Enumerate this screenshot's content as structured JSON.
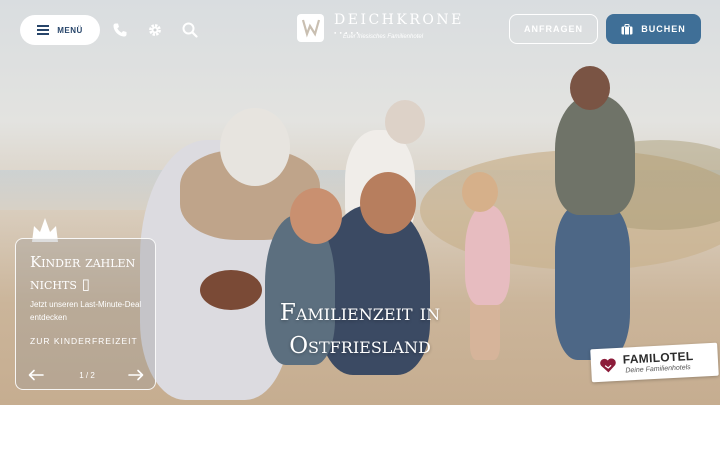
{
  "header": {
    "menu_label": "MENÜ",
    "icons": [
      "phone-icon",
      "settings-icon",
      "search-icon"
    ],
    "logo": {
      "name": "DEICHKRONE",
      "tagline": "Euer friesisches Familienhotel"
    },
    "inquire_label": "ANFRAGEN",
    "book_label": "BUCHEN",
    "accent_color": "#3f6f97"
  },
  "promo": {
    "title": "Kinder zahlen nichts ▯",
    "text": "Jetzt unseren Last-Minute-Deal entdecken",
    "link_label": "ZUR KINDERFREIZEIT",
    "slide_counter": "1 / 2"
  },
  "hero": {
    "title": "Familienzeit in Ostfriesland"
  },
  "badge": {
    "name": "FAMILOTEL",
    "tagline": "Deine Familienhotels"
  }
}
